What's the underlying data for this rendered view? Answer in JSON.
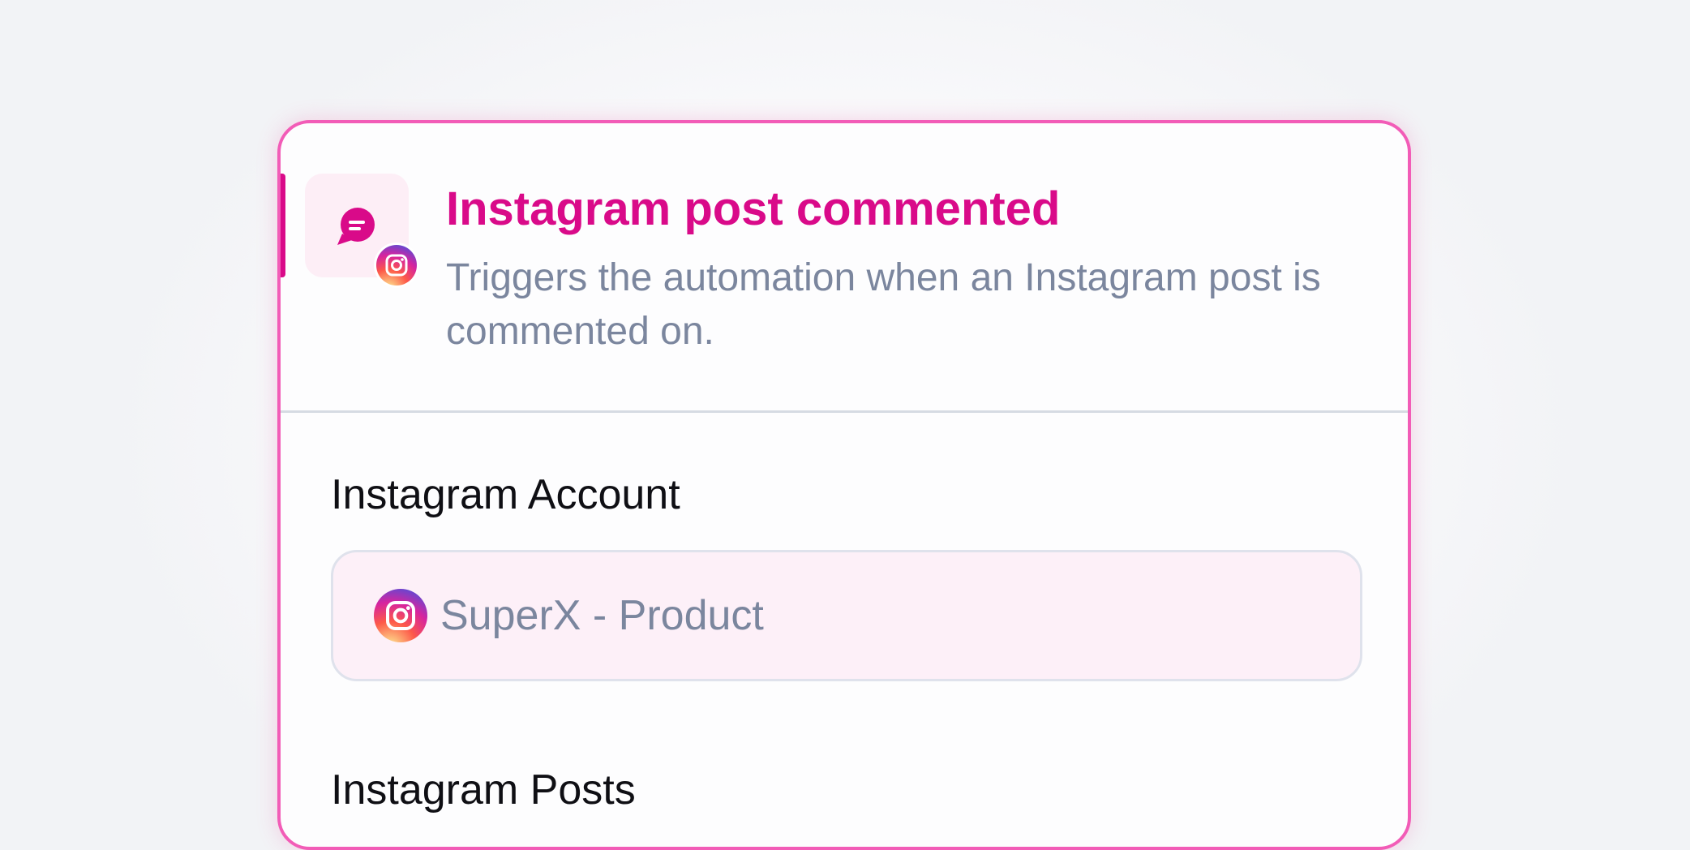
{
  "trigger": {
    "title": "Instagram post commented",
    "description": "Triggers the automation when an Instagram post is commented on.",
    "icon": "chat-bubble-icon",
    "badge_icon": "instagram-icon"
  },
  "fields": {
    "account": {
      "label": "Instagram Account",
      "value": "SuperX - Product",
      "icon": "instagram-icon"
    },
    "posts": {
      "label": "Instagram Posts"
    }
  },
  "colors": {
    "accent": "#d90a89",
    "border": "#f25cb7",
    "muted_text": "#7b869e",
    "select_background": "#fdf0f8"
  }
}
